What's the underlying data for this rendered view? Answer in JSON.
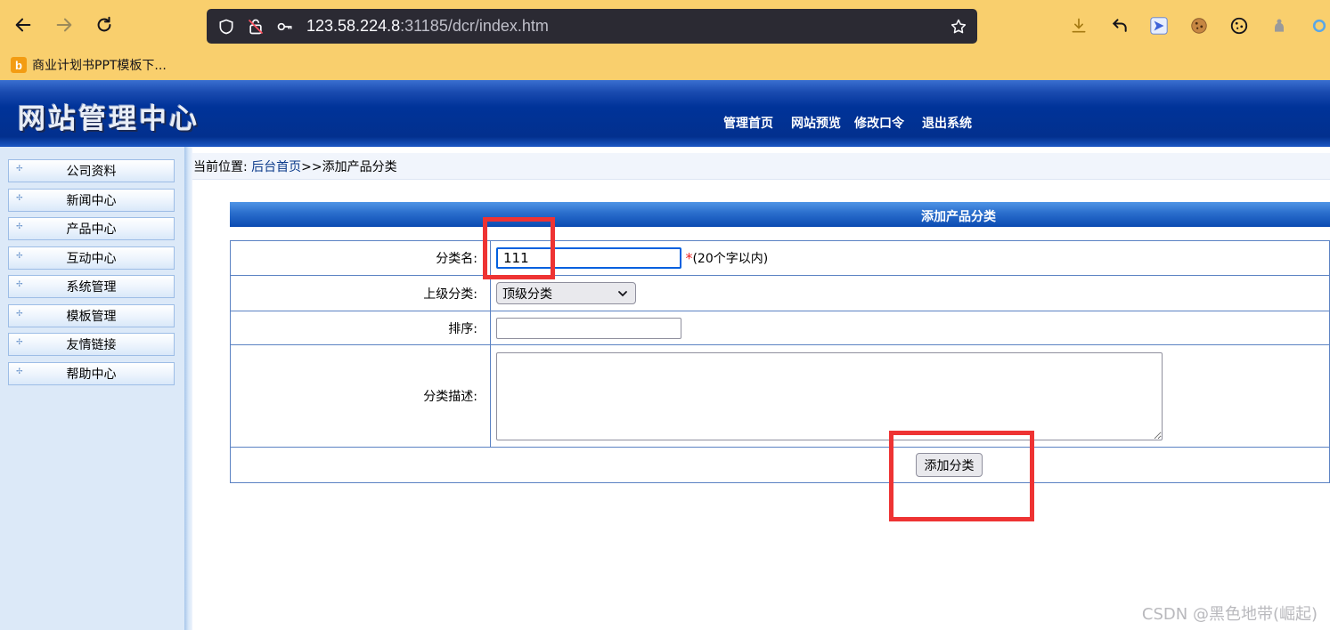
{
  "browser": {
    "url_host": "123.58.224.8",
    "url_rest": ":31185/dcr/index.htm",
    "bookmark_label": "商业计划书PPT模板下..."
  },
  "site": {
    "logo_text": "网站管理中心",
    "nav": [
      "管理首页",
      "网站预览",
      "修改口令",
      "退出系统"
    ]
  },
  "sidebar": {
    "items": [
      "公司资料",
      "新闻中心",
      "产品中心",
      "互动中心",
      "系统管理",
      "模板管理",
      "友情链接",
      "帮助中心"
    ]
  },
  "breadcrumb": {
    "prefix": "当前位置:",
    "home_link": "后台首页",
    "separator": ">>",
    "current": "添加产品分类"
  },
  "form": {
    "title": "添加产品分类",
    "name_label": "分类名:",
    "name_value": "111",
    "required_mark": "*",
    "name_hint": "(20个字以内)",
    "parent_label": "上级分类:",
    "parent_selected": "顶级分类",
    "order_label": "排序:",
    "order_value": "",
    "desc_label": "分类描述:",
    "desc_value": "",
    "submit_label": "添加分类"
  },
  "watermark": "CSDN @黑色地带(崛起)",
  "colors": {
    "browser_bar": "#f9cf6d",
    "header_blue": "#003399",
    "sidebar_bg": "#dce9f8",
    "annotation_red": "#ee3333"
  }
}
